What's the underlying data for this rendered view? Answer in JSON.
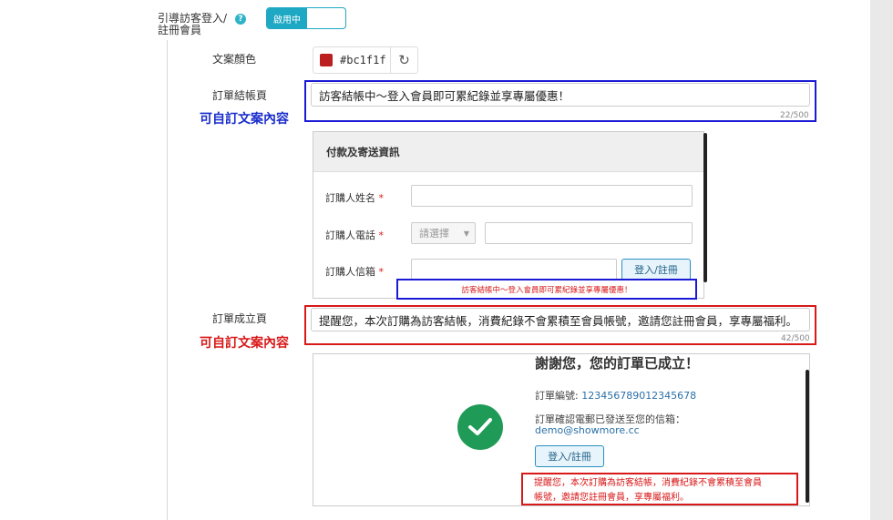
{
  "guest_setting": {
    "label_line1": "引導訪客登入/",
    "label_line2": "註冊會員",
    "help_icon": "question-circle-icon",
    "toggle_label": "啟用中"
  },
  "text_color": {
    "label": "文案顏色",
    "value": "#bc1f1f",
    "swatch_color": "#bc1f1f",
    "refresh_icon": "↻"
  },
  "checkout_page": {
    "label": "訂單結帳頁",
    "value": "訪客結帳中～登入會員即可累紀錄並享專屬優惠！",
    "counter": "22/500",
    "annotation": "可自訂文案內容"
  },
  "checkout_preview": {
    "header": "付款及寄送資訊",
    "name_label": "訂購人姓名",
    "phone_label": "訂購人電話",
    "email_label": "訂購人信箱",
    "required_mark": "*",
    "select_placeholder": "請選擇",
    "login_button": "登入/註冊",
    "tip": "訪客結帳中～登入會員即可累紀錄並享專屬優惠！"
  },
  "order_page": {
    "label": "訂單成立頁",
    "value": "提醒您，本次訂購為訪客結帳，消費紀錄不會累積至會員帳號，邀請您註冊會員，享專屬福利。",
    "counter": "42/500",
    "annotation": "可自訂文案內容"
  },
  "order_preview": {
    "title": "謝謝您，您的訂單已成立！",
    "order_no_label": "訂單編號: ",
    "order_no": "123456789012345678",
    "email_sent_label": "訂單確認電郵已發送至您的信箱：",
    "email": "demo@showmore.cc",
    "login_button": "登入/註冊",
    "tip_line1": "提醒您，本次訂購為訪客結帳，消費紀錄不會累積至會員",
    "tip_line2": "帳號，邀請您註冊會員，享專屬福利。"
  }
}
